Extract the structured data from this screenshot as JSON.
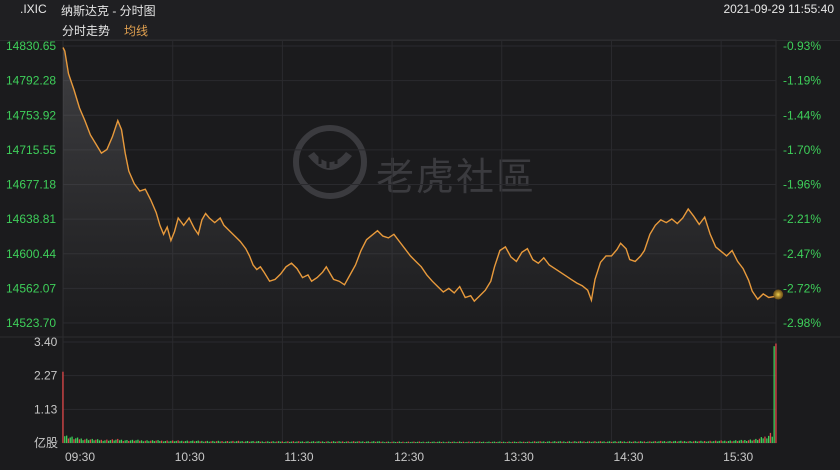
{
  "header": {
    "symbol": ".IXIC",
    "title": "纳斯达克 - 分时图",
    "datetime": "2021-09-29 11:55:40"
  },
  "tabs": {
    "trend": "分时走势",
    "avg": "均线"
  },
  "watermark": "老虎社區",
  "colors": {
    "background": "#1b1b1d",
    "price_line": "#e89a3c",
    "up": "#3ecf5a",
    "down": "#e0484a",
    "avg_tab": "#e0a050"
  },
  "chart_data": [
    {
      "type": "line",
      "title": "",
      "xlabel": "",
      "ylabel": "",
      "x_ticks": [
        "09:30",
        "10:30",
        "11:30",
        "12:30",
        "13:30",
        "14:30",
        "15:30"
      ],
      "y_ticks": [
        "14830.65",
        "14792.28",
        "14753.92",
        "14715.55",
        "14677.18",
        "14638.81",
        "14600.44",
        "14562.07",
        "14523.70"
      ],
      "y_ticks_right": [
        "-0.93%",
        "-1.19%",
        "-1.44%",
        "-1.70%",
        "-1.96%",
        "-2.21%",
        "-2.47%",
        "-2.72%",
        "-2.98%"
      ],
      "ylim": [
        14523.7,
        14830.65
      ],
      "xlim_minutes": [
        0,
        390
      ],
      "series": [
        {
          "points": [
            [
              0,
              14829
            ],
            [
              1,
              14825
            ],
            [
              3,
              14800
            ],
            [
              6,
              14782
            ],
            [
              9,
              14762
            ],
            [
              12,
              14748
            ],
            [
              15,
              14732
            ],
            [
              18,
              14722
            ],
            [
              21,
              14712
            ],
            [
              24,
              14716
            ],
            [
              27,
              14730
            ],
            [
              30,
              14748
            ],
            [
              32,
              14738
            ],
            [
              34,
              14712
            ],
            [
              36,
              14692
            ],
            [
              39,
              14678
            ],
            [
              42,
              14670
            ],
            [
              45,
              14672
            ],
            [
              48,
              14660
            ],
            [
              51,
              14646
            ],
            [
              53,
              14632
            ],
            [
              55,
              14622
            ],
            [
              57,
              14630
            ],
            [
              59,
              14615
            ],
            [
              61,
              14625
            ],
            [
              63,
              14640
            ],
            [
              66,
              14632
            ],
            [
              69,
              14640
            ],
            [
              72,
              14628
            ],
            [
              74,
              14622
            ],
            [
              76,
              14638
            ],
            [
              78,
              14645
            ],
            [
              80,
              14640
            ],
            [
              83,
              14635
            ],
            [
              86,
              14640
            ],
            [
              88,
              14632
            ],
            [
              91,
              14626
            ],
            [
              94,
              14620
            ],
            [
              97,
              14614
            ],
            [
              100,
              14606
            ],
            [
              102,
              14598
            ],
            [
              104,
              14588
            ],
            [
              106,
              14583
            ],
            [
              108,
              14586
            ],
            [
              110,
              14580
            ],
            [
              113,
              14570
            ],
            [
              116,
              14572
            ],
            [
              119,
              14578
            ],
            [
              122,
              14586
            ],
            [
              125,
              14590
            ],
            [
              128,
              14584
            ],
            [
              131,
              14574
            ],
            [
              134,
              14577
            ],
            [
              136,
              14570
            ],
            [
              139,
              14574
            ],
            [
              142,
              14580
            ],
            [
              144,
              14586
            ],
            [
              146,
              14579
            ],
            [
              148,
              14572
            ],
            [
              151,
              14570
            ],
            [
              154,
              14566
            ],
            [
              157,
              14577
            ],
            [
              160,
              14588
            ],
            [
              163,
              14604
            ],
            [
              166,
              14616
            ],
            [
              169,
              14621
            ],
            [
              172,
              14626
            ],
            [
              175,
              14620
            ],
            [
              178,
              14618
            ],
            [
              181,
              14622
            ],
            [
              184,
              14614
            ],
            [
              187,
              14606
            ],
            [
              190,
              14598
            ],
            [
              193,
              14592
            ],
            [
              196,
              14586
            ],
            [
              199,
              14577
            ],
            [
              202,
              14570
            ],
            [
              205,
              14564
            ],
            [
              208,
              14558
            ],
            [
              211,
              14562
            ],
            [
              214,
              14557
            ],
            [
              217,
              14564
            ],
            [
              220,
              14552
            ],
            [
              223,
              14554
            ],
            [
              225,
              14548
            ],
            [
              228,
              14554
            ],
            [
              231,
              14560
            ],
            [
              234,
              14570
            ],
            [
              236,
              14586
            ],
            [
              239,
              14604
            ],
            [
              242,
              14608
            ],
            [
              245,
              14597
            ],
            [
              248,
              14592
            ],
            [
              251,
              14602
            ],
            [
              254,
              14606
            ],
            [
              257,
              14594
            ],
            [
              260,
              14590
            ],
            [
              263,
              14596
            ],
            [
              266,
              14588
            ],
            [
              269,
              14584
            ],
            [
              272,
              14580
            ],
            [
              275,
              14576
            ],
            [
              278,
              14572
            ],
            [
              281,
              14568
            ],
            [
              284,
              14565
            ],
            [
              287,
              14560
            ],
            [
              289,
              14549
            ],
            [
              291,
              14572
            ],
            [
              294,
              14591
            ],
            [
              297,
              14598
            ],
            [
              300,
              14598
            ],
            [
              303,
              14605
            ],
            [
              305,
              14612
            ],
            [
              308,
              14606
            ],
            [
              310,
              14594
            ],
            [
              313,
              14592
            ],
            [
              316,
              14598
            ],
            [
              318,
              14604
            ],
            [
              321,
              14622
            ],
            [
              324,
              14632
            ],
            [
              327,
              14638
            ],
            [
              330,
              14635
            ],
            [
              333,
              14639
            ],
            [
              336,
              14634
            ],
            [
              339,
              14640
            ],
            [
              342,
              14650
            ],
            [
              345,
              14642
            ],
            [
              348,
              14633
            ],
            [
              351,
              14641
            ],
            [
              354,
              14622
            ],
            [
              357,
              14608
            ],
            [
              360,
              14603
            ],
            [
              363,
              14598
            ],
            [
              366,
              14604
            ],
            [
              369,
              14592
            ],
            [
              372,
              14584
            ],
            [
              375,
              14571
            ],
            [
              377,
              14559
            ],
            [
              380,
              14550
            ],
            [
              383,
              14556
            ],
            [
              386,
              14552
            ],
            [
              389,
              14553
            ]
          ]
        }
      ]
    },
    {
      "type": "bar",
      "title": "",
      "ylabel": "亿股",
      "y_ticks": [
        "3.40",
        "2.27",
        "1.13",
        "亿股"
      ],
      "ylim": [
        0,
        3.4
      ],
      "series": [
        {
          "points": [
            [
              0,
              2.4
            ],
            [
              1,
              0.25
            ],
            [
              2,
              0.22
            ],
            [
              3,
              0.2
            ],
            [
              4,
              0.19
            ],
            [
              5,
              0.18
            ],
            [
              6,
              0.16
            ],
            [
              8,
              0.15
            ],
            [
              10,
              0.14
            ],
            [
              12,
              0.13
            ],
            [
              15,
              0.12
            ],
            [
              20,
              0.1
            ],
            [
              25,
              0.1
            ],
            [
              30,
              0.11
            ],
            [
              35,
              0.09
            ],
            [
              40,
              0.09
            ],
            [
              45,
              0.08
            ],
            [
              50,
              0.08
            ],
            [
              60,
              0.07
            ],
            [
              70,
              0.07
            ],
            [
              80,
              0.06
            ],
            [
              90,
              0.06
            ],
            [
              100,
              0.06
            ],
            [
              110,
              0.05
            ],
            [
              120,
              0.05
            ],
            [
              130,
              0.05
            ],
            [
              140,
              0.05
            ],
            [
              150,
              0.05
            ],
            [
              160,
              0.05
            ],
            [
              170,
              0.05
            ],
            [
              180,
              0.04
            ],
            [
              190,
              0.04
            ],
            [
              200,
              0.04
            ],
            [
              210,
              0.04
            ],
            [
              220,
              0.04
            ],
            [
              230,
              0.04
            ],
            [
              240,
              0.04
            ],
            [
              250,
              0.04
            ],
            [
              260,
              0.05
            ],
            [
              270,
              0.05
            ],
            [
              280,
              0.05
            ],
            [
              290,
              0.05
            ],
            [
              300,
              0.05
            ],
            [
              310,
              0.05
            ],
            [
              320,
              0.05
            ],
            [
              330,
              0.06
            ],
            [
              340,
              0.06
            ],
            [
              350,
              0.06
            ],
            [
              360,
              0.07
            ],
            [
              370,
              0.08
            ],
            [
              375,
              0.1
            ],
            [
              380,
              0.12
            ],
            [
              383,
              0.18
            ],
            [
              385,
              0.22
            ],
            [
              387,
              0.3
            ],
            [
              388,
              0.28
            ],
            [
              389,
              3.35
            ]
          ]
        }
      ]
    }
  ]
}
